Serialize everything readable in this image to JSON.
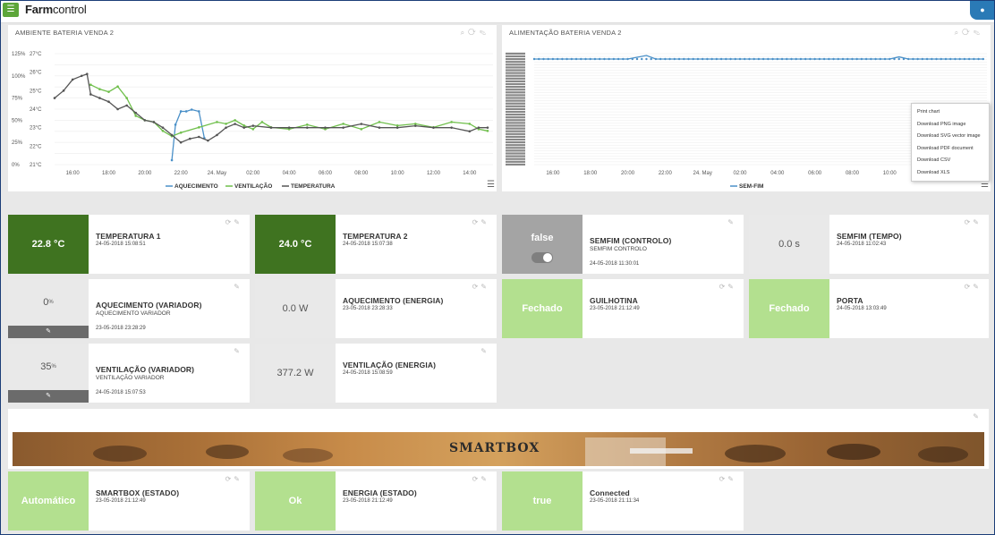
{
  "app": {
    "logo_bold": "Farm",
    "logo_rest": "control",
    "menu_icon": "menu-icon",
    "corner_icon": "user-icon"
  },
  "chart_left": {
    "title": "AMBIENTE BATERIA VENDA 2",
    "chart_data": {
      "type": "line",
      "x_ticks": [
        "16:00",
        "18:00",
        "20:00",
        "22:00",
        "24. May",
        "02:00",
        "04:00",
        "06:00",
        "08:00",
        "10:00",
        "12:00",
        "14:00"
      ],
      "y_left_ticks": [
        "0%",
        "25%",
        "50%",
        "75%",
        "100%",
        "125%"
      ],
      "y_right_ticks": [
        "21°C",
        "22°C",
        "23°C",
        "24°C",
        "25°C",
        "26°C",
        "27°C"
      ],
      "series": [
        {
          "name": "AQUECIMENTO",
          "color": "#4a90c8",
          "x": [
            21.5,
            21.7,
            22.0,
            22.3,
            22.6,
            23.0,
            23.3
          ],
          "y": [
            5,
            45,
            60,
            60,
            62,
            60,
            30
          ]
        },
        {
          "name": "VENTILAÇÃO",
          "color": "#6fbf4b",
          "x": [
            17.0,
            17.5,
            18.0,
            18.5,
            19.0,
            19.5,
            20.0,
            20.5,
            21.0,
            21.5,
            22.0,
            23.0,
            24.0,
            24.5,
            25.0,
            25.5,
            26.0,
            26.5,
            27.0,
            28.0,
            29.0,
            30.0,
            31.0,
            32.0,
            33.0,
            34.0,
            35.0,
            36.0,
            37.0,
            38.0,
            38.5,
            39.0
          ],
          "y": [
            90,
            85,
            82,
            88,
            75,
            55,
            50,
            48,
            38,
            32,
            36,
            42,
            48,
            46,
            50,
            44,
            40,
            48,
            42,
            40,
            45,
            40,
            46,
            40,
            48,
            44,
            46,
            42,
            48,
            46,
            40,
            38
          ]
        },
        {
          "name": "TEMPERATURA",
          "color": "#555555",
          "x": [
            15.0,
            15.5,
            16.0,
            16.5,
            16.8,
            17.0,
            17.5,
            18.0,
            18.5,
            19.0,
            19.5,
            20.0,
            20.5,
            21.0,
            21.5,
            22.0,
            22.5,
            23.0,
            23.5,
            24.0,
            24.5,
            25.0,
            25.5,
            26.0,
            27.0,
            28.0,
            29.0,
            30.0,
            31.0,
            32.0,
            33.0,
            34.0,
            35.0,
            36.0,
            37.0,
            38.0,
            38.5,
            39.0
          ],
          "y": [
            24.6,
            25.0,
            25.6,
            25.8,
            25.9,
            24.8,
            24.6,
            24.4,
            24.0,
            24.2,
            23.8,
            23.4,
            23.3,
            23.0,
            22.6,
            22.2,
            22.4,
            22.5,
            22.3,
            22.6,
            23.0,
            23.2,
            23.0,
            23.1,
            23.0,
            23.0,
            23.0,
            23.0,
            23.0,
            23.2,
            23.0,
            23.0,
            23.1,
            23.0,
            23.0,
            22.8,
            23.0,
            23.0
          ]
        }
      ],
      "legend": [
        "AQUECIMENTO",
        "VENTILAÇÃO",
        "TEMPERATURA"
      ]
    }
  },
  "chart_right": {
    "title": "ALIMENTAÇÃO BATERIA VENDA 2",
    "chart_data": {
      "type": "line",
      "x_ticks": [
        "16:00",
        "18:00",
        "20:00",
        "22:00",
        "24. May",
        "02:00",
        "04:00",
        "06:00",
        "08:00",
        "10:00",
        "12:00"
      ],
      "series": [
        {
          "name": "SEM-FIM",
          "color": "#4a90c8",
          "x": [
            15.0,
            20.0,
            21.0,
            21.5,
            22.0,
            30.0,
            34.0,
            34.5,
            35.0,
            39.0
          ],
          "y": [
            1,
            1,
            1.05,
            1,
            1,
            1,
            1,
            1.03,
            1,
            1
          ]
        }
      ],
      "legend": [
        "SEM-FIM"
      ]
    },
    "context_menu": [
      "Print chart",
      "Download PNG image",
      "Download SVG vector image",
      "Download PDF document",
      "Download CSV",
      "Download XLS"
    ]
  },
  "widgets": {
    "temp1": {
      "value": "22.8 °C",
      "title": "TEMPERATURA 1",
      "date": "24-05-2018 15:08:51"
    },
    "temp2": {
      "value": "24.0 °C",
      "title": "TEMPERATURA 2",
      "date": "24-05-2018 15:07:38"
    },
    "semfim_ctrl": {
      "value": "false",
      "title": "SEMFIM (CONTROLO)",
      "sub": "SEMFIM CONTROLO",
      "date": "24-05-2018 11:30:01"
    },
    "semfim_tempo": {
      "value": "0.0 s",
      "title": "SEMFIM (TEMPO)",
      "date": "24-05-2018 11:02:43"
    },
    "aquec_var": {
      "value": "0",
      "unit": "%",
      "title": "AQUECIMENTO (VARIADOR)",
      "sub": "AQUECIMENTO VARIADOR",
      "date": "23-05-2018 23:28:29"
    },
    "aquec_energia": {
      "value": "0.0 W",
      "title": "AQUECIMENTO (ENERGIA)",
      "date": "23-05-2018 23:28:33"
    },
    "guilhotina": {
      "value": "Fechado",
      "title": "GUILHOTINA",
      "date": "23-05-2018 21:12:49"
    },
    "porta": {
      "value": "Fechado",
      "title": "PORTA",
      "date": "24-05-2018 13:03:49"
    },
    "vent_var": {
      "value": "35",
      "unit": "%",
      "title": "VENTILAÇÃO (VARIADOR)",
      "sub": "VENTILAÇÃO VARIADOR",
      "date": "24-05-2018 15:07:53"
    },
    "vent_energia": {
      "value": "377.2 W",
      "title": "VENTILAÇÃO (ENERGIA)",
      "date": "24-05-2018 15:08:59"
    },
    "smartbox_estado": {
      "value": "Automático",
      "title": "SMARTBOX (ESTADO)",
      "date": "23-05-2018 21:12:49"
    },
    "energia_estado": {
      "value": "Ok",
      "title": "ENERGIA (ESTADO)",
      "date": "23-05-2018 21:12:49"
    },
    "connected": {
      "value": "true",
      "title": "Connected",
      "date": "23-05-2018 21:11:34"
    }
  },
  "banner": {
    "text": "SMARTBOX"
  }
}
